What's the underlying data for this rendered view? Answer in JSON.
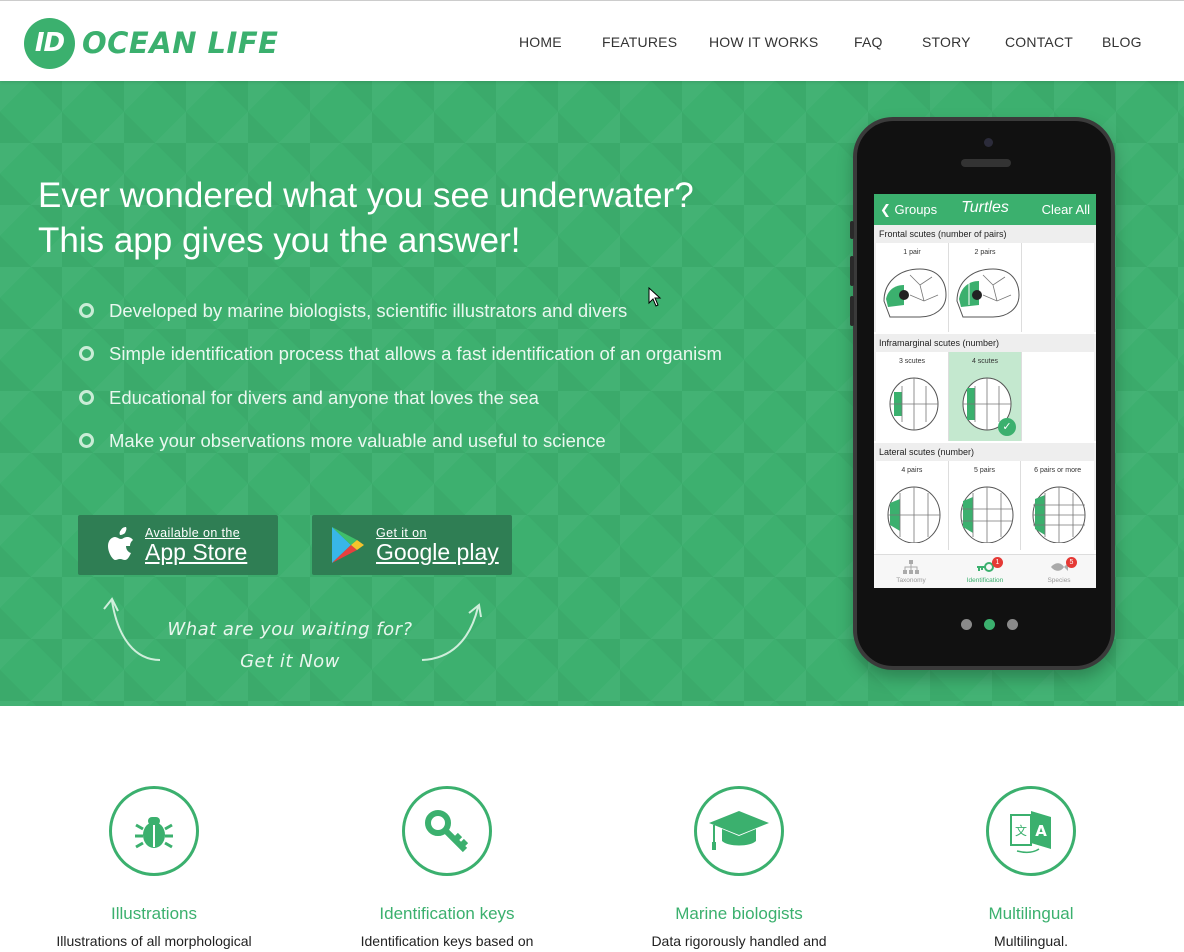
{
  "brand": {
    "logo_mark": "ID",
    "name": "OCEAN LIFE",
    "accent": "#3bb06e",
    "hero_bg": "#3db06f"
  },
  "nav": [
    "HOME",
    "FEATURES",
    "HOW IT WORKS",
    "FAQ",
    "STORY",
    "CONTACT",
    "BLOG"
  ],
  "hero": {
    "headline_line1": "Ever wondered what you see underwater?",
    "headline_line2": "This app gives you the answer!",
    "features": [
      "Developed by marine biologists, scientific illustrators and divers",
      "Simple identification process that allows a fast identification of an organism",
      "Educational for divers and anyone that loves the sea",
      "Make your observations more valuable and useful to science"
    ],
    "appstore": {
      "small": "Available on the",
      "big": "App Store"
    },
    "googleplay": {
      "small": "Get it on",
      "big": "Google play"
    },
    "cta_line1": "What are you waiting for?",
    "cta_line2": "Get it Now"
  },
  "phone": {
    "back_label": "Groups",
    "title": "Turtles",
    "clear_label": "Clear All",
    "sections": [
      {
        "label": "Frontal scutes (number of pairs)",
        "options": [
          "1 pair",
          "2 pairs"
        ],
        "selected": null
      },
      {
        "label": "Inframarginal scutes (number)",
        "options": [
          "3 scutes",
          "4 scutes"
        ],
        "selected": "4 scutes"
      },
      {
        "label": "Lateral scutes (number)",
        "options": [
          "4 pairs",
          "5 pairs",
          "6 pairs or more"
        ],
        "selected": null
      }
    ],
    "tabs": [
      {
        "label": "Taxonomy",
        "icon": "hierarchy-icon",
        "badge": ""
      },
      {
        "label": "Identification",
        "icon": "key-icon",
        "badge": "1"
      },
      {
        "label": "Species",
        "icon": "fish-icon",
        "badge": "5"
      }
    ],
    "carousel_active": 2
  },
  "cards": [
    {
      "icon": "bug-icon",
      "title": "Illustrations",
      "desc": "Illustrations of all morphological"
    },
    {
      "icon": "key-icon",
      "title": "Identification keys",
      "desc": "Identification keys based on"
    },
    {
      "icon": "graduation-cap-icon",
      "title": "Marine biologists",
      "desc": "Data rigorously handled and"
    },
    {
      "icon": "translate-icon",
      "title": "Multilingual",
      "desc": "Multilingual."
    }
  ]
}
